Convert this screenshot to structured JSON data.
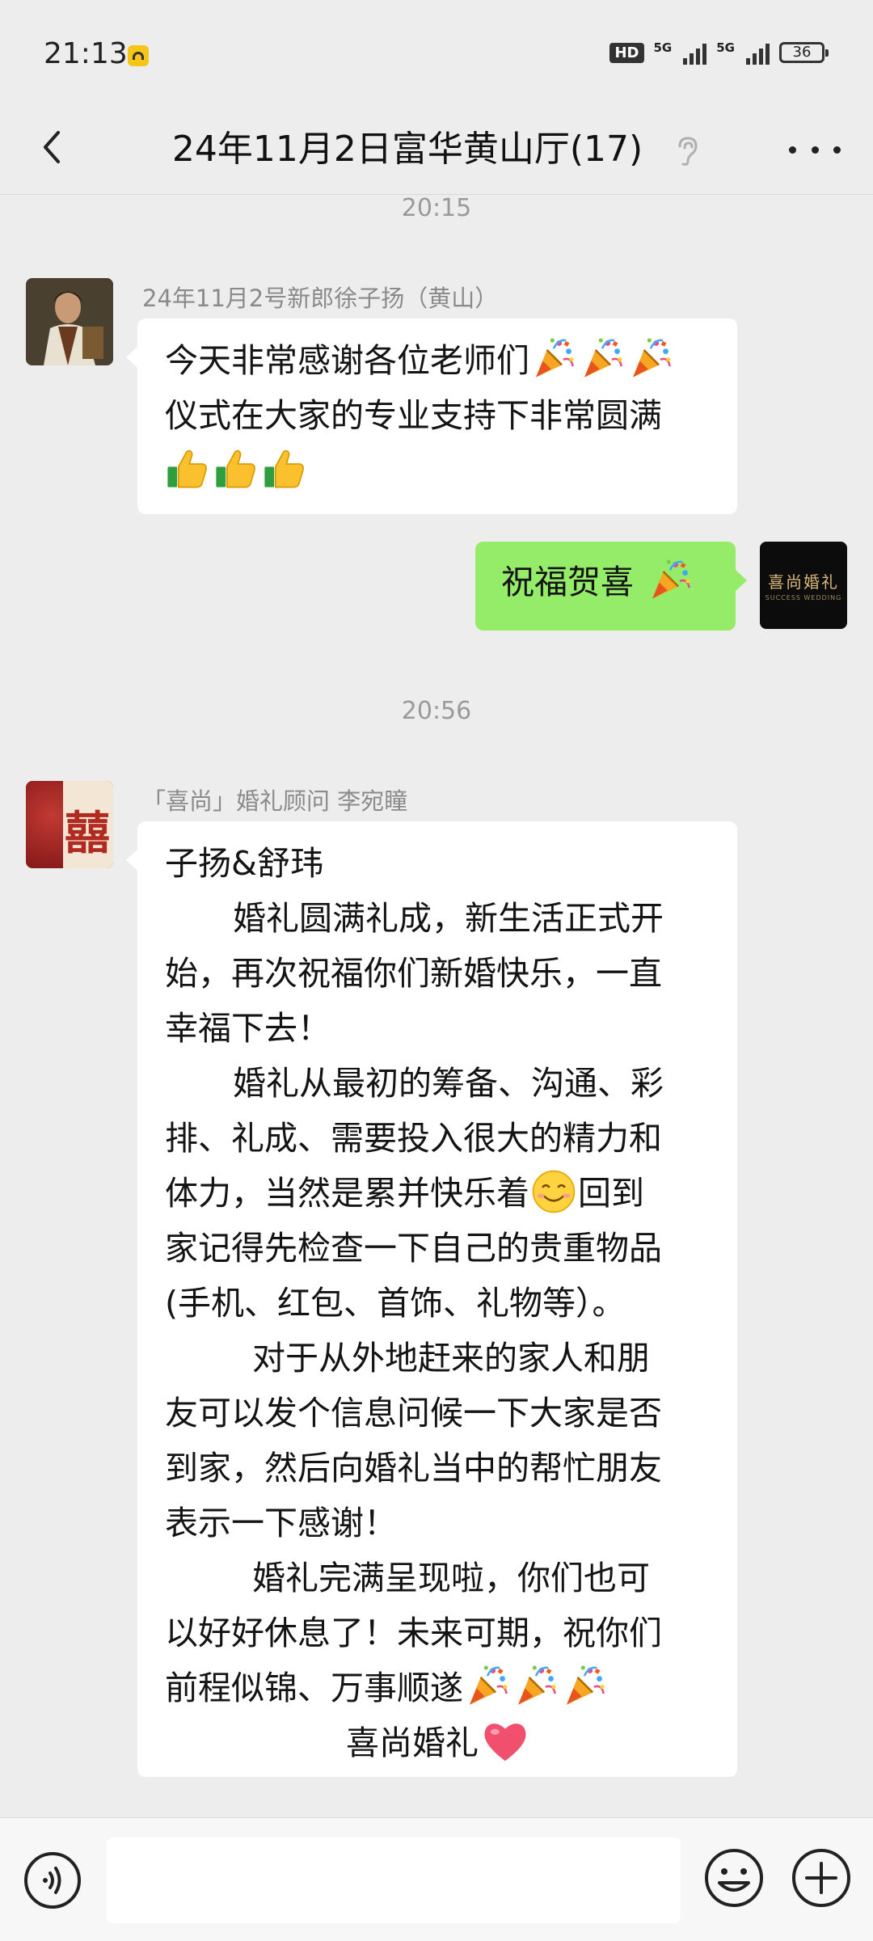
{
  "status_bar": {
    "time": "21:13",
    "hd_label": "HD",
    "network_1": "5G",
    "network_2": "5G",
    "battery": "36"
  },
  "nav": {
    "title": "24年11月2日富华黄山厅(17)"
  },
  "timestamps": [
    "20:15",
    "20:56"
  ],
  "messages": [
    {
      "sender": "24年11月2号新郎徐子扬（黄山）",
      "lines": [
        "今天非常感谢各位老师们",
        "仪式在大家的专业支持下非常圆满"
      ],
      "emoji": [
        "party-popper-icon",
        "thumbs-up-icon"
      ]
    },
    {
      "sender": "me",
      "text": "祝福贺喜",
      "avatar_text": "喜尚婚礼",
      "avatar_subtext": "SUCCESS WEDDING"
    },
    {
      "sender": "「喜尚」婚礼顾问 李宛瞳",
      "avatar_text": "囍",
      "lines": [
        "子扬&舒玮",
        "婚礼圆满礼成，新生活正式开",
        "始，再次祝福你们新婚快乐，一直",
        "幸福下去！",
        "婚礼从最初的筹备、沟通、彩",
        "排、礼成、需要投入很大的精力和",
        "体力，当然是累并快乐着",
        "回到",
        "家记得先检查一下自己的贵重物品",
        "(手机、红包、首饰、礼物等）。",
        "对于从外地赶来的家人和朋",
        "友可以发个信息问候一下大家是否",
        "到家，然后向婚礼当中的帮忙朋友",
        "表示一下感谢！",
        "婚礼完满呈现啦，你们也可",
        "以好好休息了！未来可期，祝你们",
        "前程似锦、万事顺遂",
        "喜尚婚礼"
      ]
    }
  ],
  "input": {
    "placeholder": ""
  },
  "colors": {
    "background": "#ededed",
    "bubble_self": "#95ec69",
    "bubble_other": "#ffffff"
  }
}
